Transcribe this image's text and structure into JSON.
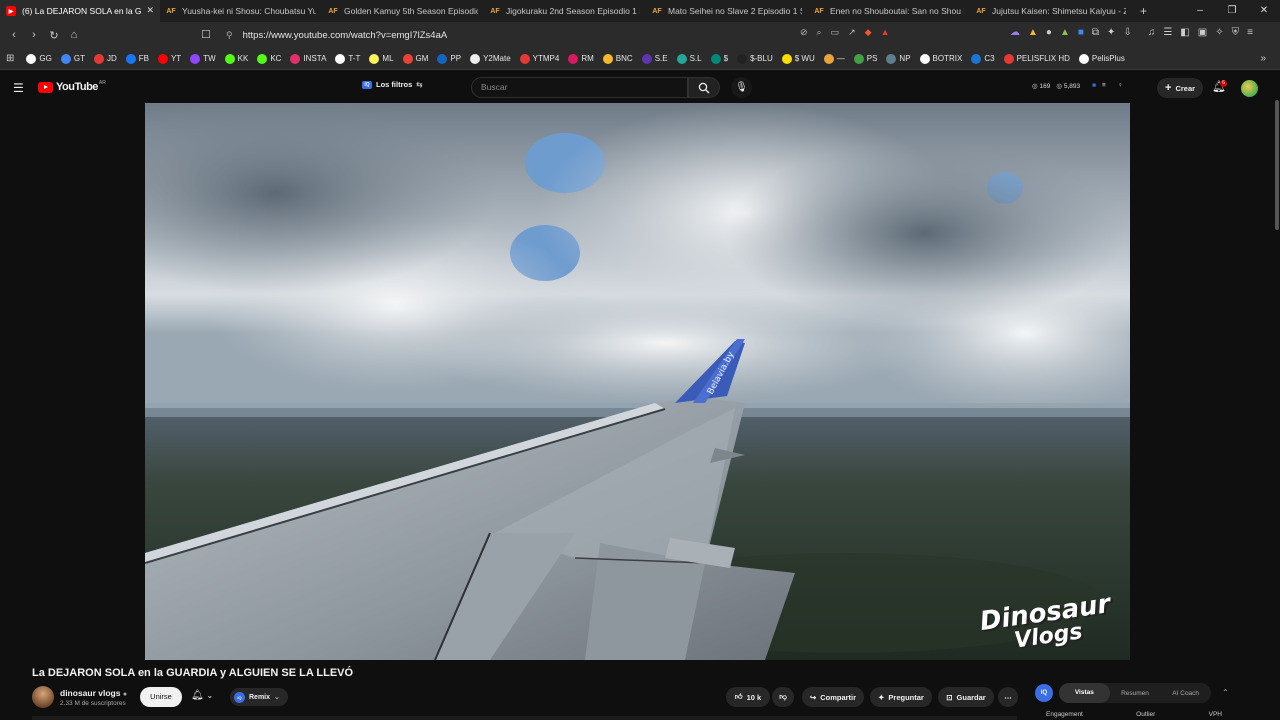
{
  "browser": {
    "tabs": [
      {
        "label": "(6) La DEJARON SOLA en la G",
        "fav": "▶",
        "active": true
      },
      {
        "label": "Yuusha-kei ni Shosu: Choubatsu Yuu",
        "fav": "AF",
        "active": false
      },
      {
        "label": "Golden Kamuy 5th Season Episodio",
        "fav": "AF",
        "active": false
      },
      {
        "label": "Jigokuraku 2nd Season Episodio 1 S",
        "fav": "AF",
        "active": false
      },
      {
        "label": "Mato Seihei no Slave 2 Episodio 1 S",
        "fav": "AF",
        "active": false
      },
      {
        "label": "Enen no Shouboutai: San no Shou E",
        "fav": "AF",
        "active": false
      },
      {
        "label": "Jujutsu Kaisen: Shimetsu Kaiyuu - Ze",
        "fav": "AF",
        "active": false
      }
    ],
    "url": "https://www.youtube.com/watch?v=emgI7lZs4aA",
    "bookmarks": [
      {
        "label": "GG",
        "color": "#ffffff"
      },
      {
        "label": "GT",
        "color": "#4285f4"
      },
      {
        "label": "JD",
        "color": "#e53935"
      },
      {
        "label": "FB",
        "color": "#1877f2"
      },
      {
        "label": "YT",
        "color": "#ff0000"
      },
      {
        "label": "TW",
        "color": "#9146ff"
      },
      {
        "label": "KK",
        "color": "#53fc18"
      },
      {
        "label": "KC",
        "color": "#53fc18"
      },
      {
        "label": "INSTA",
        "color": "#e1306c"
      },
      {
        "label": "T-T",
        "color": "#ffffff"
      },
      {
        "label": "ML",
        "color": "#fff159"
      },
      {
        "label": "GM",
        "color": "#ea4335"
      },
      {
        "label": "PP",
        "color": "#1565c0"
      },
      {
        "label": "Y2Mate",
        "color": "#eeeeee"
      },
      {
        "label": "YTMP4",
        "color": "#e53935"
      },
      {
        "label": "RM",
        "color": "#d81b60"
      },
      {
        "label": "BNC",
        "color": "#f3ba2f"
      },
      {
        "label": "S.E",
        "color": "#5e35b1"
      },
      {
        "label": "S.L",
        "color": "#26a69a"
      },
      {
        "label": "$",
        "color": "#00897b"
      },
      {
        "label": "$-BLU",
        "color": "#222222"
      },
      {
        "label": "$ WU",
        "color": "#ffdd00"
      },
      {
        "label": "—",
        "color": "#e8a53a"
      },
      {
        "label": "PS",
        "color": "#43a047"
      },
      {
        "label": "NP",
        "color": "#607d8b"
      },
      {
        "label": "BOTRIX",
        "color": "#ffffff"
      },
      {
        "label": "C3",
        "color": "#1976d2"
      },
      {
        "label": "PELISFLIX HD",
        "color": "#e53935"
      },
      {
        "label": "PelisPlus",
        "color": "#ffffff"
      }
    ]
  },
  "youtube": {
    "logo_text": "YouTube",
    "logo_country": "AR",
    "filters_label": "Los filtros",
    "search_placeholder": "Buscar",
    "stat_a": "169",
    "stat_b": "5,893",
    "create_label": "Crear",
    "notif_count": "6"
  },
  "video": {
    "watermark_line1": "Dinosaur",
    "watermark_line2": "Vlogs",
    "wing_text": "Belavia.by",
    "title": "La DEJARON SOLA en la GUARDIA y ALGUIEN SE LA LLEVÓ",
    "channel_name": "dinosaur vlogs",
    "subscribers": "2.33 M de suscriptores",
    "join_label": "Unirse",
    "remix_label": "Remix",
    "likes": "10 k",
    "share_label": "Compartir",
    "ask_label": "Preguntar",
    "save_label": "Guardar"
  },
  "panel": {
    "iq_label": "IQ",
    "tabs": [
      "Vistas",
      "Resumen",
      "AI Coach"
    ],
    "metrics": [
      "Engagement",
      "Outlier",
      "VPH"
    ]
  }
}
